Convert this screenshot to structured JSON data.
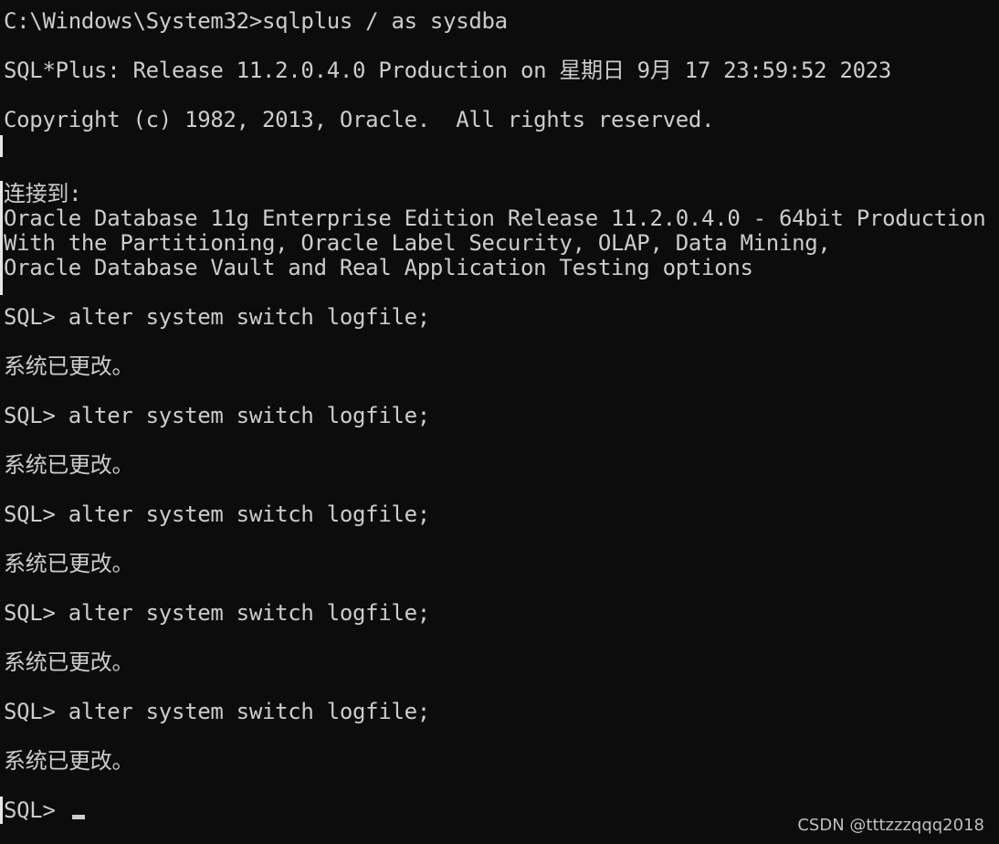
{
  "terminal": {
    "lines": [
      "C:\\Windows\\System32>sqlplus / as sysdba",
      "",
      "SQL*Plus: Release 11.2.0.4.0 Production on 星期日 9月 17 23:59:52 2023",
      "",
      "Copyright (c) 1982, 2013, Oracle.  All rights reserved.",
      "",
      "",
      "连接到:",
      "Oracle Database 11g Enterprise Edition Release 11.2.0.4.0 - 64bit Production",
      "With the Partitioning, Oracle Label Security, OLAP, Data Mining,",
      "Oracle Database Vault and Real Application Testing options",
      "",
      "SQL> alter system switch logfile;",
      "",
      "系统已更改。",
      "",
      "SQL> alter system switch logfile;",
      "",
      "系统已更改。",
      "",
      "SQL> alter system switch logfile;",
      "",
      "系统已更改。",
      "",
      "SQL> alter system switch logfile;",
      "",
      "系统已更改。",
      "",
      "SQL> alter system switch logfile;",
      "",
      "系统已更改。",
      "",
      "SQL> "
    ]
  },
  "watermark": "CSDN @tttzzzqqq2018",
  "colors": {
    "background": "#0c0c0c",
    "text": "#cccccc"
  }
}
